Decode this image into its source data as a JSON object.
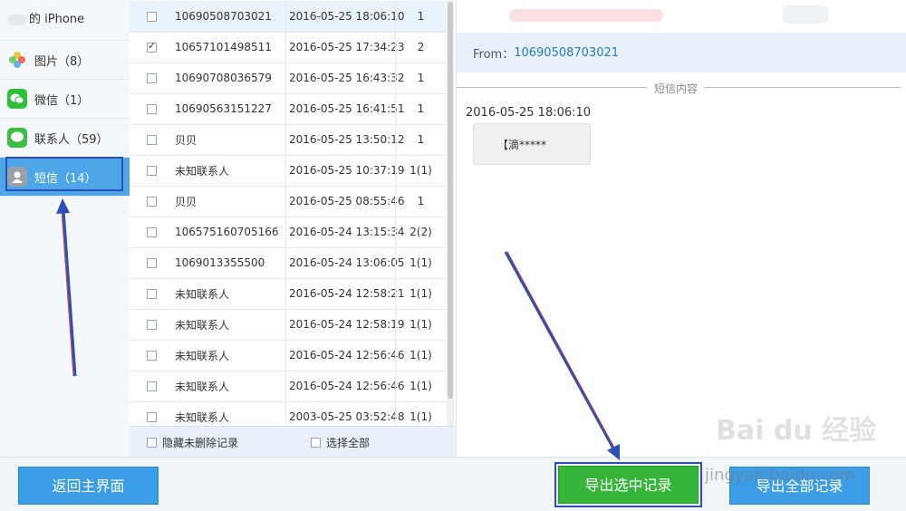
{
  "sidebar": {
    "device_label": "的 iPhone",
    "items": [
      {
        "label": "图片（8）",
        "icon": "photos-icon",
        "color": "#f0a030"
      },
      {
        "label": "微信（1）",
        "icon": "wechat-icon",
        "color": "#2ec03a"
      },
      {
        "label": "联系人（59）",
        "icon": "contacts-icon",
        "color": "#3cc043"
      },
      {
        "label": "短信（14）",
        "icon": "messages-icon",
        "color": "#8a8f96",
        "active": true
      }
    ]
  },
  "messages": [
    {
      "sender": "10690508703021",
      "datetime": "2016-05-25 18:06:10",
      "count": "1",
      "checked": false,
      "selected": true
    },
    {
      "sender": "10657101498511",
      "datetime": "2016-05-25 17:34:23",
      "count": "2",
      "checked": true
    },
    {
      "sender": "10690708036579",
      "datetime": "2016-05-25 16:43:32",
      "count": "1",
      "checked": false
    },
    {
      "sender": "10690563151227",
      "datetime": "2016-05-25 16:41:51",
      "count": "1",
      "checked": false
    },
    {
      "sender": "贝贝",
      "datetime": "2016-05-25 13:50:12",
      "count": "1",
      "checked": false
    },
    {
      "sender": "未知联系人",
      "datetime": "2016-05-25 10:37:19",
      "count": "1(1)",
      "checked": false
    },
    {
      "sender": "贝贝",
      "datetime": "2016-05-25 08:55:46",
      "count": "1",
      "checked": false
    },
    {
      "sender": "106575160705166",
      "datetime": "2016-05-24 13:15:34",
      "count": "2(2)",
      "checked": false
    },
    {
      "sender": "1069013355500",
      "datetime": "2016-05-24 13:06:05",
      "count": "1(1)",
      "checked": false
    },
    {
      "sender": "未知联系人",
      "datetime": "2016-05-24 12:58:21",
      "count": "1(1)",
      "checked": false
    },
    {
      "sender": "未知联系人",
      "datetime": "2016-05-24 12:58:19",
      "count": "1(1)",
      "checked": false
    },
    {
      "sender": "未知联系人",
      "datetime": "2016-05-24 12:56:46",
      "count": "1(1)",
      "checked": false
    },
    {
      "sender": "未知联系人",
      "datetime": "2016-05-24 12:56:46",
      "count": "1(1)",
      "checked": false
    },
    {
      "sender": "未知联系人",
      "datetime": "2003-05-25 03:52:48",
      "count": "1(1)",
      "checked": false
    }
  ],
  "list_footer": {
    "hide_deleted_label": "隐藏未删除记录",
    "select_all_label": "选择全部"
  },
  "detail": {
    "from_prefix": "From：",
    "from_value": "10690508703021",
    "section_label": "短信内容",
    "message_time": "2016-05-25 18:06:10",
    "message_text": "【滴*****"
  },
  "buttons": {
    "back": "返回主界面",
    "export_selected": "导出选中记录",
    "export_all": "导出全部记录"
  },
  "watermark": {
    "logo_text": "Bai du 经验",
    "url": "jingyan.baidu.com"
  },
  "colors": {
    "accent": "#4da6e8",
    "export_green": "#36b53a",
    "annotation": "#2d4fb8"
  }
}
